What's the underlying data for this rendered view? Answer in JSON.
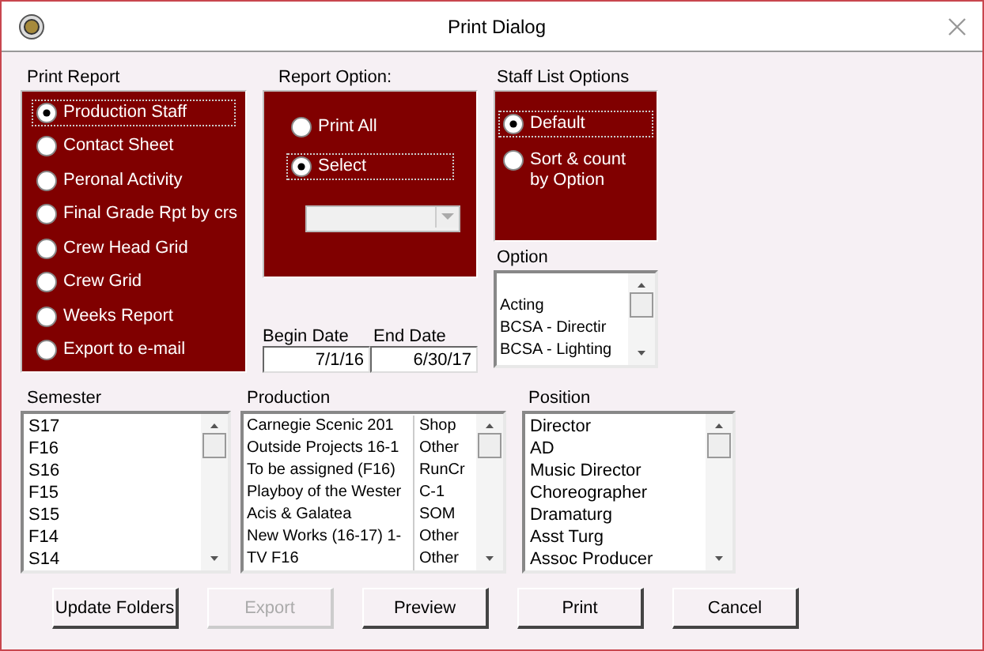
{
  "window": {
    "title": "Print Dialog"
  },
  "print_report": {
    "label": "Print Report",
    "options": [
      {
        "label": "Production Staff",
        "selected": true
      },
      {
        "label": "Contact Sheet",
        "selected": false
      },
      {
        "label": "Peronal Activity",
        "selected": false
      },
      {
        "label": "Final Grade Rpt by crs",
        "selected": false
      },
      {
        "label": "Crew Head Grid",
        "selected": false
      },
      {
        "label": "Crew Grid",
        "selected": false
      },
      {
        "label": "Weeks Report",
        "selected": false
      },
      {
        "label": "Export to e-mail",
        "selected": false
      }
    ]
  },
  "report_option": {
    "label": "Report Option:",
    "options": [
      {
        "label": "Print All",
        "selected": false
      },
      {
        "label": "Select",
        "selected": true
      }
    ]
  },
  "dates": {
    "begin_label": "Begin Date",
    "end_label": "End Date",
    "begin": "7/1/16",
    "end": "6/30/17"
  },
  "staff_list_options": {
    "label": "Staff List Options",
    "options": [
      {
        "label": "Default",
        "selected": true
      },
      {
        "label": "Sort & count by Option",
        "selected": false
      }
    ]
  },
  "option": {
    "label": "Option",
    "items": [
      "Acting",
      "BCSA - Directir",
      "BCSA - Lighting"
    ]
  },
  "semester": {
    "label": "Semester",
    "items": [
      "S17",
      "F16",
      "S16",
      "F15",
      "S15",
      "F14",
      "S14"
    ]
  },
  "production": {
    "label": "Production",
    "rows": [
      {
        "name": "Carnegie Scenic 201",
        "type": "Shop"
      },
      {
        "name": "Outside Projects 16-1",
        "type": "Other"
      },
      {
        "name": "To be assigned (F16)",
        "type": "RunCr"
      },
      {
        "name": "Playboy of the Wester",
        "type": "C-1"
      },
      {
        "name": "Acis & Galatea",
        "type": "SOM"
      },
      {
        "name": "New Works (16-17) 1-",
        "type": "Other"
      },
      {
        "name": "TV F16",
        "type": "Other"
      }
    ]
  },
  "position": {
    "label": "Position",
    "items": [
      "Director",
      "AD",
      "Music Director",
      "Choreographer",
      "Dramaturg",
      "Asst Turg",
      "Assoc Producer"
    ]
  },
  "buttons": [
    {
      "label": "Update Folders",
      "disabled": false
    },
    {
      "label": "Export",
      "disabled": true
    },
    {
      "label": "Preview",
      "disabled": false
    },
    {
      "label": "Print",
      "disabled": false
    },
    {
      "label": "Cancel",
      "disabled": false
    }
  ]
}
